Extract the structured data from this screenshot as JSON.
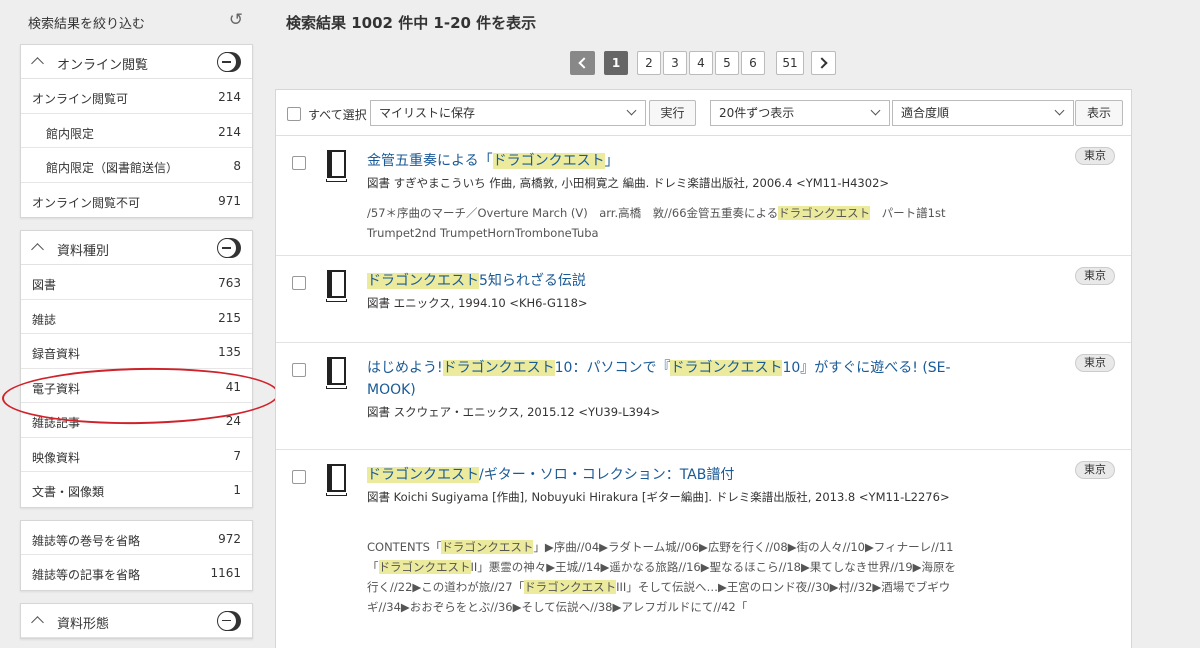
{
  "sidebar": {
    "title": "検索結果を絞り込む",
    "panels": [
      {
        "title": "オンライン閲覧",
        "rows": [
          {
            "label": "オンライン閲覧可",
            "count": "214"
          },
          {
            "label": "館内限定",
            "count": "214"
          },
          {
            "label": "館内限定（図書館送信）",
            "count": "8"
          },
          {
            "label": "オンライン閲覧不可",
            "count": "971"
          }
        ]
      },
      {
        "title": "資料種別",
        "rows": [
          {
            "label": "図書",
            "count": "763"
          },
          {
            "label": "雑誌",
            "count": "215"
          },
          {
            "label": "録音資料",
            "count": "135"
          },
          {
            "label": "電子資料",
            "count": "41"
          },
          {
            "label": "雑誌記事",
            "count": "24"
          },
          {
            "label": "映像資料",
            "count": "7"
          },
          {
            "label": "文書・図像類",
            "count": "1"
          }
        ]
      },
      {
        "rows": [
          {
            "label": "雑誌等の巻号を省略",
            "count": "972"
          },
          {
            "label": "雑誌等の記事を省略",
            "count": "1161"
          }
        ]
      },
      {
        "title": "資料形態"
      }
    ]
  },
  "summary": "検索結果 1002 件中 1-20 件を表示",
  "pager": {
    "pages": [
      "1",
      "2",
      "3",
      "4",
      "5",
      "6",
      "51"
    ]
  },
  "toolbar": {
    "select_all": "すべて選択",
    "mylist_select": "マイリストに保存",
    "execute": "実行",
    "per_page": "20件ずつ表示",
    "sort": "適合度順",
    "display": "表示"
  },
  "results": [
    {
      "title_pre": "金管五重奏による「",
      "title_hl": "ドラゴンクエスト",
      "title_post": "」",
      "meta": "図書 すぎやまこういち 作曲, 高橋敦, 小田桐寛之 編曲. ドレミ楽譜出版社, 2006.4 <YM11-H4302>",
      "contents_pre": "/57＊序曲のマーチ／Overture March (V)　arr.高橋　敦//66金管五重奏による",
      "contents_hl": "ドラゴンクエスト",
      "contents_post": "　パート譜1st Trumpet2nd TrumpetHornTromboneTuba",
      "badge": "東京"
    },
    {
      "title_hl": "ドラゴンクエスト",
      "title_post": "5知られざる伝説",
      "meta": "図書 エニックス, 1994.10 <KH6-G118>",
      "badge": "東京"
    },
    {
      "title_pre": "はじめよう!",
      "title_hl": "ドラゴンクエスト",
      "title_mid": "10：パソコンで『",
      "title_hl2": "ドラゴンクエスト",
      "title_post": "10』がすぐに遊べる! (SE-MOOK)",
      "meta": "図書 スクウェア・エニックス, 2015.12 <YU39-L394>",
      "badge": "東京"
    },
    {
      "title_hl": "ドラゴンクエスト",
      "title_post": "/ギター・ソロ・コレクション：TAB譜付",
      "meta": "図書 Koichi Sugiyama [作曲], Nobuyuki Hirakura [ギター編曲]. ドレミ楽譜出版社, 2013.8 <YM11-L2276>",
      "contents_1": "CONTENTS「",
      "contents_hl1": "ドラゴンクエスト",
      "contents_2": "」▶序曲//04▶ラダトーム城//06▶広野を行く//08▶街の人々//10▶フィナーレ//11「",
      "contents_hl2": "ドラゴンクエスト",
      "contents_3": "II」悪霊の神々▶王城//14▶遥かなる旅路//16▶聖なるほこら//18▶果てしなき世界//19▶海原を行く//22▶この道わが旅//27「",
      "contents_hl3": "ドラゴンクエスト",
      "contents_4": "III」そして伝説へ…▶王宮のロンド夜//30▶村//32▶酒場でブギウギ//34▶おおぞらをとぶ//36▶そして伝説へ//38▶アレフガルドにて//42「",
      "badge": "東京"
    }
  ],
  "colors": {
    "link": "#1a5a96",
    "highlight": "#eceb9d",
    "annotation_circle": "#d0222a"
  }
}
